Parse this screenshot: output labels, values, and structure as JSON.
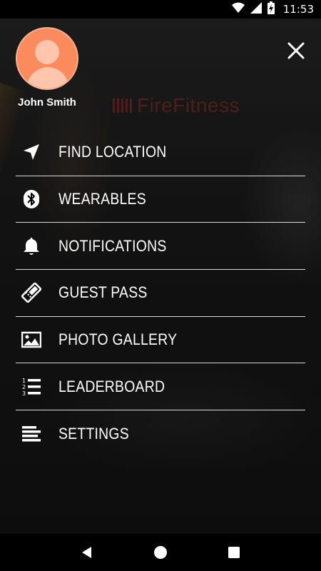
{
  "status_bar": {
    "time": "11:53",
    "icons": [
      "wifi-icon",
      "signal-icon",
      "battery-charging-icon"
    ]
  },
  "background": {
    "brand_text": "FireFitness",
    "brand_color": "#c0392b"
  },
  "drawer": {
    "user_name": "John Smith",
    "avatar_color": "#fb8a5d",
    "close_icon": "close-icon",
    "items": [
      {
        "label": "FIND LOCATION",
        "icon": "location-arrow-icon"
      },
      {
        "label": "WEARABLES",
        "icon": "bluetooth-icon"
      },
      {
        "label": "NOTIFICATIONS",
        "icon": "bell-icon"
      },
      {
        "label": "GUEST PASS",
        "icon": "ticket-icon"
      },
      {
        "label": "PHOTO GALLERY",
        "icon": "image-icon"
      },
      {
        "label": "LEADERBOARD",
        "icon": "numbered-list-icon"
      },
      {
        "label": "SETTINGS",
        "icon": "settings-lines-icon"
      }
    ]
  },
  "nav_bar": {
    "buttons": [
      "back-icon",
      "home-icon",
      "recents-icon"
    ]
  }
}
